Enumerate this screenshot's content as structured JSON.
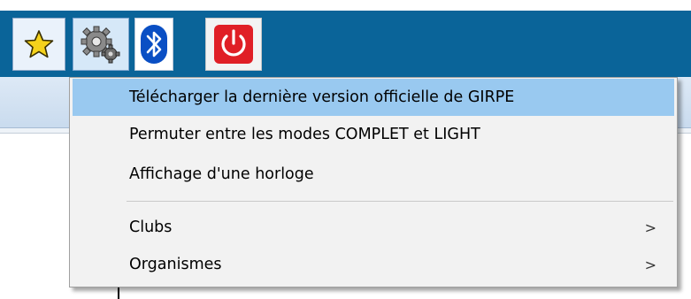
{
  "toolbar": {
    "buttons": [
      {
        "icon": "star-icon",
        "color": "#f5d21b"
      },
      {
        "icon": "gear-icon",
        "color": "#7a7a7a"
      },
      {
        "icon": "bluetooth-icon",
        "color": "#0a4fc4"
      },
      {
        "icon": "power-icon",
        "color": "#e01f26"
      }
    ],
    "background_color": "#0a6499"
  },
  "menu": {
    "highlight_color": "#99c9f0",
    "items": [
      {
        "label": "Télécharger la dernière version officielle de GIRPE",
        "highlighted": true
      },
      {
        "label": "Permuter entre les modes COMPLET et LIGHT"
      },
      {
        "label": "Affichage d'une horloge"
      },
      {
        "label": "Clubs",
        "submenu_arrow": ">"
      },
      {
        "label": "Organismes",
        "submenu_arrow": ">"
      }
    ]
  }
}
